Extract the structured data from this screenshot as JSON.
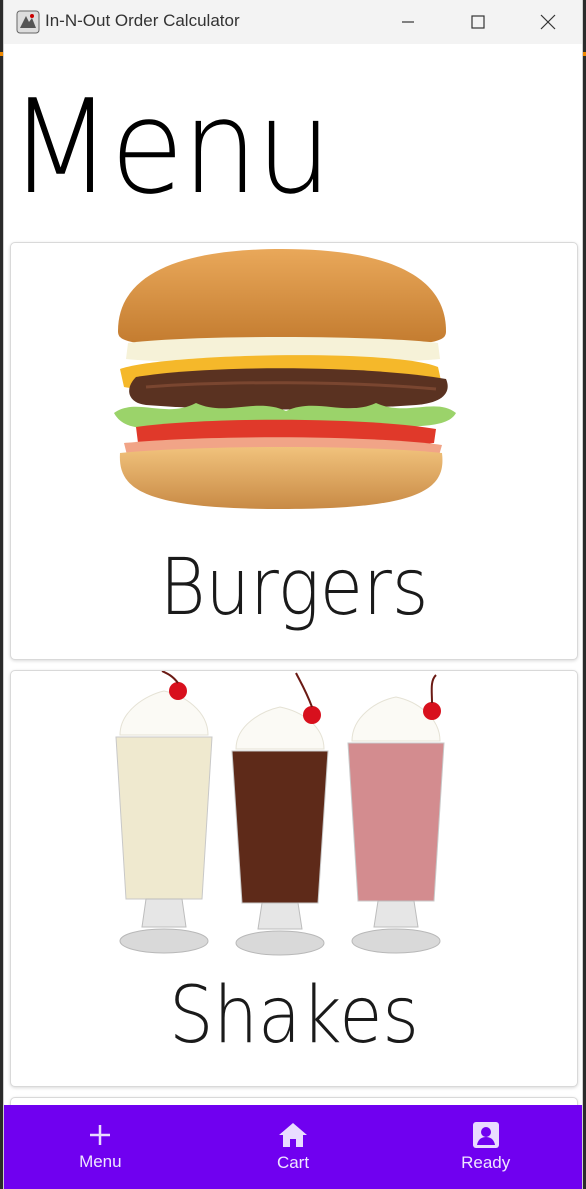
{
  "window": {
    "title": "In-N-Out Order Calculator",
    "controls": [
      "minimize-icon",
      "maximize-icon",
      "close-icon"
    ]
  },
  "page": {
    "heading": "Menu"
  },
  "menu_cards": [
    {
      "label": "Burgers",
      "image": "burger-image"
    },
    {
      "label": "Shakes",
      "image": "milkshakes-image"
    }
  ],
  "bottom_nav": {
    "background": "#7000f0",
    "items": [
      {
        "label": "Menu",
        "icon": "plus-icon"
      },
      {
        "label": "Cart",
        "icon": "home-icon"
      },
      {
        "label": "Ready",
        "icon": "account-box-icon"
      }
    ]
  }
}
